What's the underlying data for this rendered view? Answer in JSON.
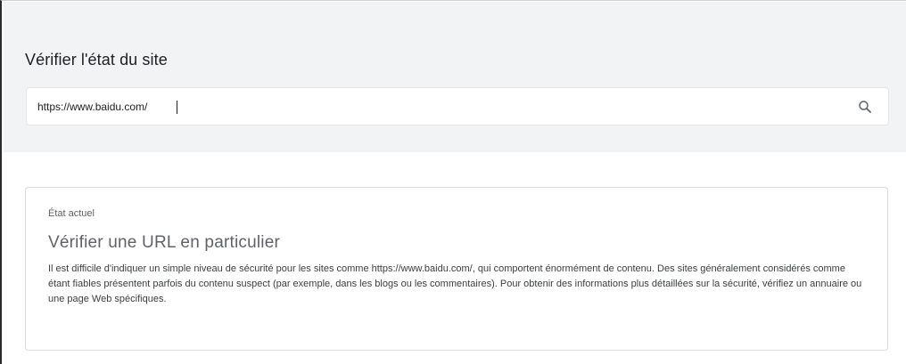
{
  "header": {
    "title": "Vérifier l'état du site"
  },
  "search": {
    "value": "https://www.baidu.com/",
    "icon": "search-icon"
  },
  "status": {
    "label": "État actuel",
    "heading": "Vérifier une URL en particulier",
    "description": "Il est difficile d'indiquer un simple niveau de sécurité pour les sites comme https://www.baidu.com/, qui comportent énormément de contenu. Des sites généralement considérés comme étant fiables présentent parfois du contenu suspect (par exemple, dans les blogs ou les commentaires). Pour obtenir des informations plus détaillées sur la sécurité, vérifiez un annuaire ou une page Web spécifiques."
  },
  "colors": {
    "panel_background": "#f1f3f4",
    "text_primary": "#202124",
    "text_secondary": "#5f6368",
    "card_border": "#dadce0"
  }
}
